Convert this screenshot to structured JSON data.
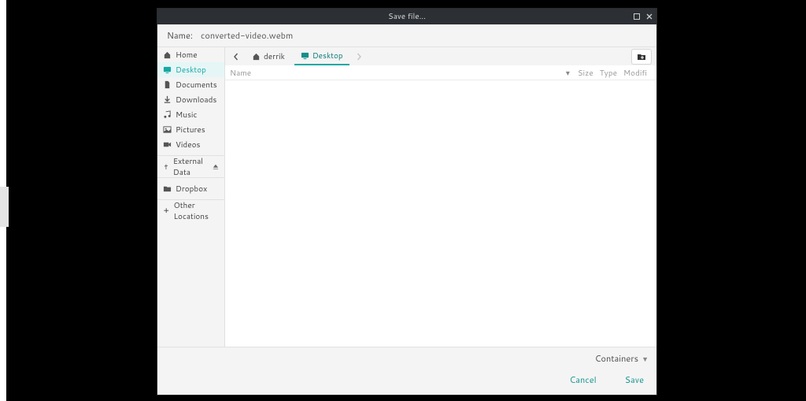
{
  "window": {
    "title": "Save file..."
  },
  "name_field": {
    "label": "Name:",
    "value": "converted-video.webm"
  },
  "sidebar": {
    "items": [
      {
        "label": "Home",
        "icon": "home-icon"
      },
      {
        "label": "Desktop",
        "icon": "desktop-icon",
        "active": true
      },
      {
        "label": "Documents",
        "icon": "document-icon"
      },
      {
        "label": "Downloads",
        "icon": "download-icon"
      },
      {
        "label": "Music",
        "icon": "music-icon"
      },
      {
        "label": "Pictures",
        "icon": "pictures-icon"
      },
      {
        "label": "Videos",
        "icon": "video-icon"
      }
    ],
    "devices": [
      {
        "label": "External Data",
        "icon": "usb-icon",
        "ejectable": true
      }
    ],
    "bookmarks": [
      {
        "label": "Dropbox",
        "icon": "folder-icon"
      }
    ],
    "other": [
      {
        "label": "Other Locations",
        "icon": "plus-icon"
      }
    ]
  },
  "breadcrumb": {
    "items": [
      {
        "label": "derrik",
        "icon": "home-icon"
      },
      {
        "label": "Desktop",
        "icon": "desktop-icon",
        "active": true
      }
    ]
  },
  "columns": {
    "name": "Name",
    "size": "Size",
    "type": "Type",
    "modified": "Modifi"
  },
  "filter": {
    "label": "Containers"
  },
  "actions": {
    "cancel": "Cancel",
    "save": "Save"
  }
}
